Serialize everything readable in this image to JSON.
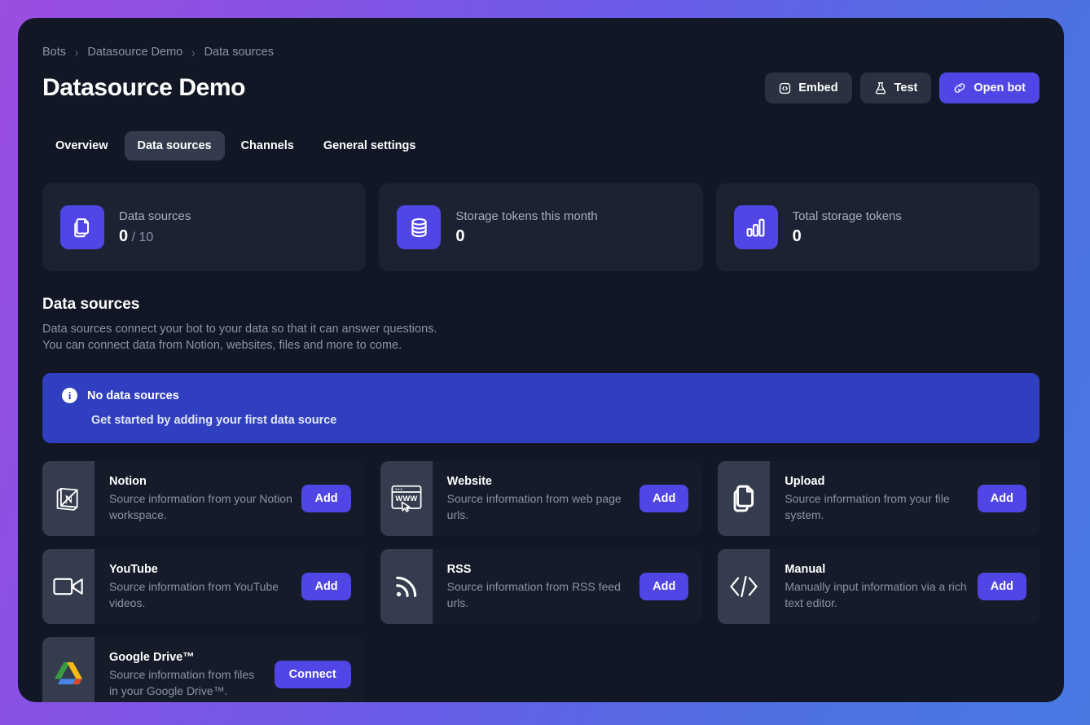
{
  "window": {
    "background_gradient_from": "#9b4ee0",
    "background_gradient_to": "#4a79e2",
    "panel_bg": "#121726"
  },
  "breadcrumb": {
    "items": [
      {
        "label": "Bots"
      },
      {
        "label": "Datasource Demo"
      },
      {
        "label": "Data sources"
      }
    ],
    "separator": "›"
  },
  "header": {
    "title": "Datasource Demo",
    "actions": [
      {
        "label": "Embed",
        "icon": "embed-code-icon",
        "style": "dark"
      },
      {
        "label": "Test",
        "icon": "flask-icon",
        "style": "dark"
      },
      {
        "label": "Open bot",
        "icon": "link-icon",
        "style": "primary"
      }
    ]
  },
  "tabs": [
    {
      "label": "Overview",
      "active": false
    },
    {
      "label": "Data sources",
      "active": true
    },
    {
      "label": "Channels",
      "active": false
    },
    {
      "label": "General settings",
      "active": false
    }
  ],
  "stats": [
    {
      "label": "Data sources",
      "value": "0",
      "suffix": " / 10",
      "icon": "documents-icon",
      "icon_color": "#4f46e5"
    },
    {
      "label": "Storage tokens this month",
      "value": "0",
      "suffix": "",
      "icon": "database-icon",
      "icon_color": "#4f46e5"
    },
    {
      "label": "Total storage tokens",
      "value": "0",
      "suffix": "",
      "icon": "bar-chart-icon",
      "icon_color": "#4f46e5"
    }
  ],
  "section": {
    "title": "Data sources",
    "description": "Data sources connect your bot to your data so that it can answer questions. You can connect data from Notion, websites, files and more to come."
  },
  "banner": {
    "icon": "info-icon",
    "glyph": "i",
    "title": "No data sources",
    "subtitle": "Get started by adding your first data source",
    "color": "#2f3fc0"
  },
  "sources": [
    {
      "name": "Notion",
      "description": "Source information from your Notion workspace.",
      "button": "Add",
      "icon": "notion-icon"
    },
    {
      "name": "Website",
      "description": "Source information from web page urls.",
      "button": "Add",
      "icon": "browser-www-icon"
    },
    {
      "name": "Upload",
      "description": "Source information from your file system.",
      "button": "Add",
      "icon": "documents-icon"
    },
    {
      "name": "YouTube",
      "description": "Source information from YouTube videos.",
      "button": "Add",
      "icon": "video-camera-icon"
    },
    {
      "name": "RSS",
      "description": "Source information from RSS feed urls.",
      "button": "Add",
      "icon": "rss-icon"
    },
    {
      "name": "Manual",
      "description": "Manually input information via a rich text editor.",
      "button": "Add",
      "icon": "code-brackets-icon"
    },
    {
      "name": "Google Drive™",
      "description": "Source information from files in your Google Drive™.",
      "button": "Connect",
      "icon": "google-drive-icon"
    }
  ]
}
